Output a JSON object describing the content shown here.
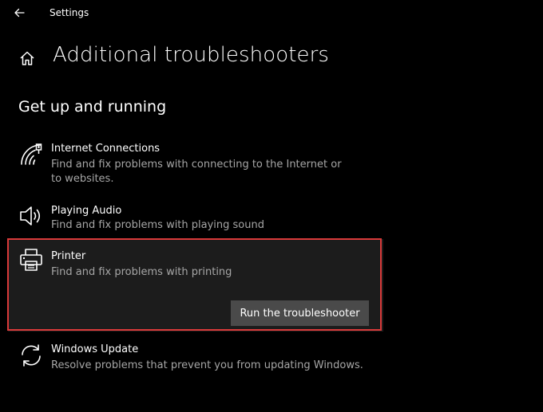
{
  "window": {
    "app_title": "Settings"
  },
  "page": {
    "title": "Additional troubleshooters"
  },
  "section": {
    "heading": "Get up and running"
  },
  "troubleshooters": [
    {
      "id": "internet",
      "icon": "wifi-icon",
      "title": "Internet Connections",
      "description": "Find and fix problems with connecting to the Internet or to websites."
    },
    {
      "id": "audio",
      "icon": "speaker-icon",
      "title": "Playing Audio",
      "description": "Find and fix problems with playing sound"
    },
    {
      "id": "printer",
      "icon": "printer-icon",
      "title": "Printer",
      "description": "Find and fix problems with printing",
      "button_label": "Run the troubleshooter",
      "selected": true
    },
    {
      "id": "update",
      "icon": "refresh-icon",
      "title": "Windows Update",
      "description": "Resolve problems that prevent you from updating Windows."
    }
  ],
  "colors": {
    "background": "#000000",
    "selected_item": "#1c1c1c",
    "button": "#4a4a4a",
    "highlight_border": "#d93a3a",
    "secondary_text": "#a6a6a6"
  }
}
